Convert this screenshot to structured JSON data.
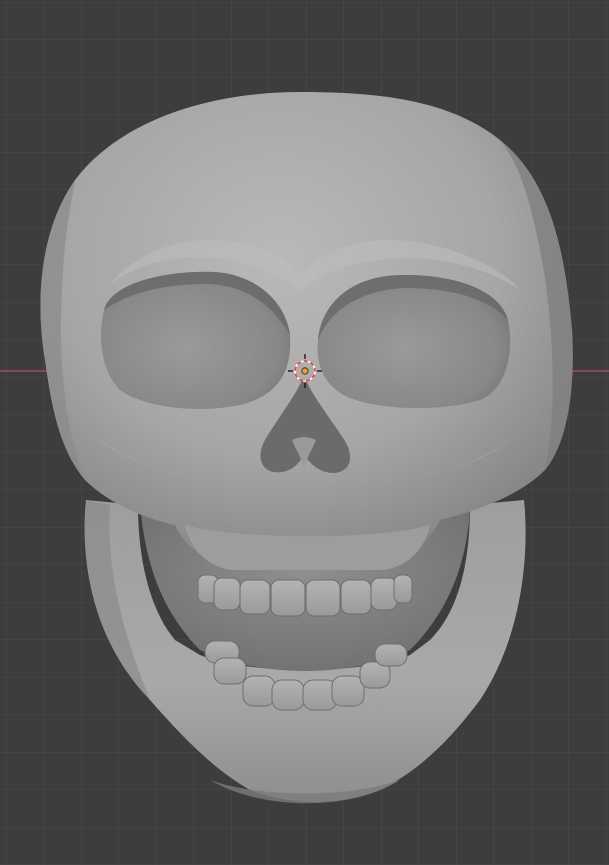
{
  "viewport": {
    "background_color": "#3d3d3d",
    "grid_line_color": "#4b4b4b",
    "x_axis_color": "#c04a55",
    "model_color": "#a3a3a3"
  },
  "scene": {
    "model": "skull-mesh",
    "shading": "solid",
    "view": "front-orthographic"
  },
  "cursor": {
    "icon": "3d-cursor-icon",
    "ring_colors": [
      "#ff3b3b",
      "#ffffff"
    ]
  },
  "origin": {
    "icon": "object-origin-dot",
    "color": "#f39c2a"
  }
}
